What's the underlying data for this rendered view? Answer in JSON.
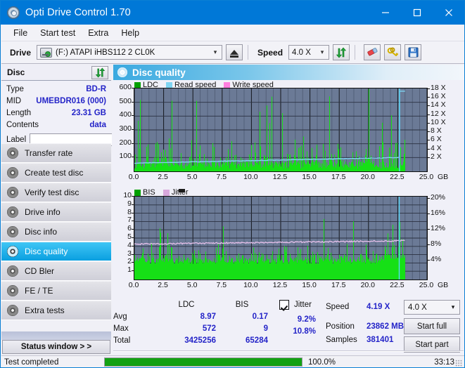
{
  "window": {
    "title": "Opti Drive Control 1.70",
    "icon": "disc-icon",
    "minimize": "minimize-icon",
    "maximize": "maximize-icon",
    "close": "close-icon"
  },
  "menu": {
    "items": [
      "File",
      "Start test",
      "Extra",
      "Help"
    ]
  },
  "toolbar": {
    "drive_label": "Drive",
    "drive_value": "(F:)  ATAPI iHBS112  2 CL0K",
    "eject_icon": "eject-icon",
    "speed_label": "Speed",
    "speed_value": "4.0 X",
    "refresh_icon": "refresh-icon",
    "eraser_icon": "eraser-icon",
    "keys_icon": "keys-icon",
    "save_icon": "save-icon"
  },
  "disc_panel": {
    "header": "Disc",
    "refresh_icon": "refresh-icon",
    "fields": [
      {
        "key": "Type",
        "value": "BD-R"
      },
      {
        "key": "MID",
        "value": "UMEBDR016 (000)"
      },
      {
        "key": "Length",
        "value": "23.31 GB"
      },
      {
        "key": "Contents",
        "value": "data"
      }
    ],
    "label_key": "Label",
    "label_value": "",
    "label_placeholder": "",
    "label_button_icon": "cd-icon"
  },
  "nav": {
    "items": [
      {
        "label": "Transfer rate",
        "selected": false
      },
      {
        "label": "Create test disc",
        "selected": false
      },
      {
        "label": "Verify test disc",
        "selected": false
      },
      {
        "label": "Drive info",
        "selected": false
      },
      {
        "label": "Disc info",
        "selected": false
      },
      {
        "label": "Disc quality",
        "selected": true
      },
      {
        "label": "CD Bler",
        "selected": false
      },
      {
        "label": "FE / TE",
        "selected": false
      },
      {
        "label": "Extra tests",
        "selected": false
      }
    ],
    "status_window_button": "Status window > >"
  },
  "content": {
    "header": "Disc quality",
    "header_icon": "disc-quality-icon"
  },
  "chart_data": [
    {
      "id": "top-chart",
      "type": "line",
      "title": "",
      "xlabel": "GB",
      "ylabel": "",
      "xlim": [
        0.0,
        25.0
      ],
      "xticks": [
        "0.0",
        "2.5",
        "5.0",
        "7.5",
        "10.0",
        "12.5",
        "15.0",
        "17.5",
        "20.0",
        "22.5",
        "25.0"
      ],
      "x_unit": "GB",
      "ylim": [
        0,
        600
      ],
      "yticks": [
        "600",
        "500",
        "400",
        "300",
        "200",
        "100"
      ],
      "ylim_right": [
        0,
        19
      ],
      "yticks_right": [
        "18 X",
        "16 X",
        "14 X",
        "12 X",
        "10 X",
        "8 X",
        "6 X",
        "4 X",
        "2 X"
      ],
      "grid": true,
      "legend_position": "top-left",
      "legend": [
        {
          "name": "LDC",
          "color": "#00a000"
        },
        {
          "name": "Read speed",
          "color": "#7fd4f2"
        },
        {
          "name": "Write speed",
          "color": "#ff7fdf"
        }
      ],
      "series": [
        {
          "name": "Read speed",
          "color": "#7fd4f2",
          "x": [
            0.0,
            1.0,
            2.0,
            3.0,
            4.0,
            5.0,
            6.0,
            7.0,
            8.0,
            9.0,
            10.0,
            11.0,
            12.0,
            13.0,
            14.0,
            15.0,
            16.0,
            17.0,
            18.0,
            19.0,
            20.0,
            21.0,
            22.0,
            22.6,
            22.7,
            23.0
          ],
          "values": [
            2.1,
            2.2,
            2.3,
            2.4,
            2.5,
            2.6,
            2.7,
            2.8,
            2.9,
            3.0,
            3.1,
            3.2,
            3.3,
            3.4,
            3.5,
            3.6,
            3.7,
            3.8,
            3.9,
            4.0,
            4.1,
            4.2,
            4.3,
            4.4,
            18.0,
            18.0
          ]
        },
        {
          "name": "LDC",
          "color": "#00d000",
          "note": "dense green error spikes across full disc; baseline near 0-60, frequent spikes 100-300, several to 500-600"
        }
      ]
    },
    {
      "id": "bottom-chart",
      "type": "line",
      "title": "",
      "xlabel": "GB",
      "ylabel": "",
      "xlim": [
        0.0,
        25.0
      ],
      "xticks": [
        "0.0",
        "2.5",
        "5.0",
        "7.5",
        "10.0",
        "12.5",
        "15.0",
        "17.5",
        "20.0",
        "22.5",
        "25.0"
      ],
      "x_unit": "GB",
      "ylim": [
        0,
        10
      ],
      "yticks": [
        "10",
        "9",
        "8",
        "7",
        "6",
        "5",
        "4",
        "3",
        "2",
        "1"
      ],
      "ylim_right": [
        0,
        20
      ],
      "yticks_right": [
        "20%",
        "16%",
        "12%",
        "8%",
        "4%"
      ],
      "grid": true,
      "legend_position": "top-left",
      "legend": [
        {
          "name": "BIS",
          "color": "#00a000"
        },
        {
          "name": "Jitter",
          "color": "#d8a8dc"
        }
      ],
      "series": [
        {
          "name": "Jitter",
          "color": "#e0b8e4",
          "x": [
            0.0,
            2.5,
            5.0,
            7.5,
            10.0,
            12.5,
            15.0,
            17.5,
            20.0,
            22.5,
            25.0
          ],
          "values": [
            8.6,
            8.7,
            8.8,
            8.9,
            9.0,
            9.1,
            9.2,
            9.3,
            9.3,
            9.3,
            9.4
          ]
        },
        {
          "name": "BIS",
          "color": "#00d000",
          "note": "dense green bars, baseline 2-3, frequent spikes 4-6, several to 7-9"
        }
      ]
    }
  ],
  "stats": {
    "columns": [
      "",
      "LDC",
      "BIS"
    ],
    "rows": [
      {
        "key": "Avg",
        "ldc": "8.97",
        "bis": "0.17"
      },
      {
        "key": "Max",
        "ldc": "572",
        "bis": "9"
      },
      {
        "key": "Total",
        "ldc": "3425256",
        "bis": "65284"
      }
    ],
    "jitter": {
      "checked": true,
      "label": "Jitter",
      "avg": "9.2%",
      "max": "10.8%"
    }
  },
  "results": {
    "speed_label": "Speed",
    "speed_value": "4.19 X",
    "position_label": "Position",
    "position_value": "23862 MB",
    "samples_label": "Samples",
    "samples_value": "381401",
    "speed_select": "4.0 X",
    "start_full_button": "Start full",
    "start_part_button": "Start part"
  },
  "statusbar": {
    "text": "Test completed",
    "progress_percent": 100.0,
    "progress_label": "100.0%",
    "elapsed": "33:13"
  }
}
